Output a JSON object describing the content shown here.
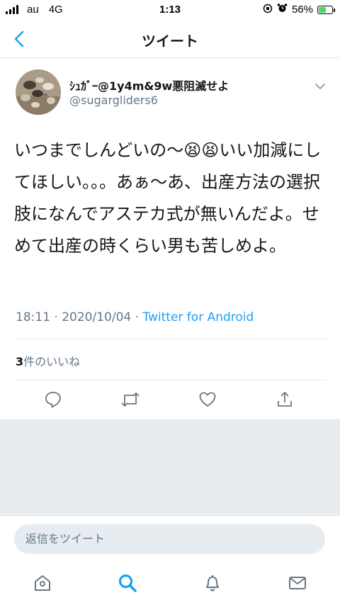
{
  "status_bar": {
    "carrier": "au",
    "network": "4G",
    "time": "1:13",
    "battery": "56%",
    "battery_level": 0.56
  },
  "header": {
    "title": "ツイート",
    "back_icon": "chevron-left-icon"
  },
  "tweet": {
    "display_name": "ｼｭｶﾞｰ@1y4m&9w悪阻滅せよ",
    "handle": "@sugargliders6",
    "text": "いつまでしんどいの〜😫😫いい加減にしてほしい。。。あぁ〜あ、出産方法の選択肢になんでアステカ式が無いんだよ。せめて出産の時くらい男も苦しめよ。",
    "time": "18:11",
    "separator": " · ",
    "date": "2020/10/04",
    "source": "Twitter for Android",
    "likes_count": "3",
    "likes_label": "件のいいね"
  },
  "actions": [
    "reply-icon",
    "retweet-icon",
    "like-icon",
    "share-icon"
  ],
  "reply_box": {
    "placeholder": "返信をツイート"
  },
  "tabbar": [
    "home-icon",
    "search-icon",
    "notifications-icon",
    "messages-icon"
  ],
  "colors": {
    "accent": "#1da1f2",
    "secondary_text": "#657786",
    "background_gray": "#e6ecf0"
  }
}
